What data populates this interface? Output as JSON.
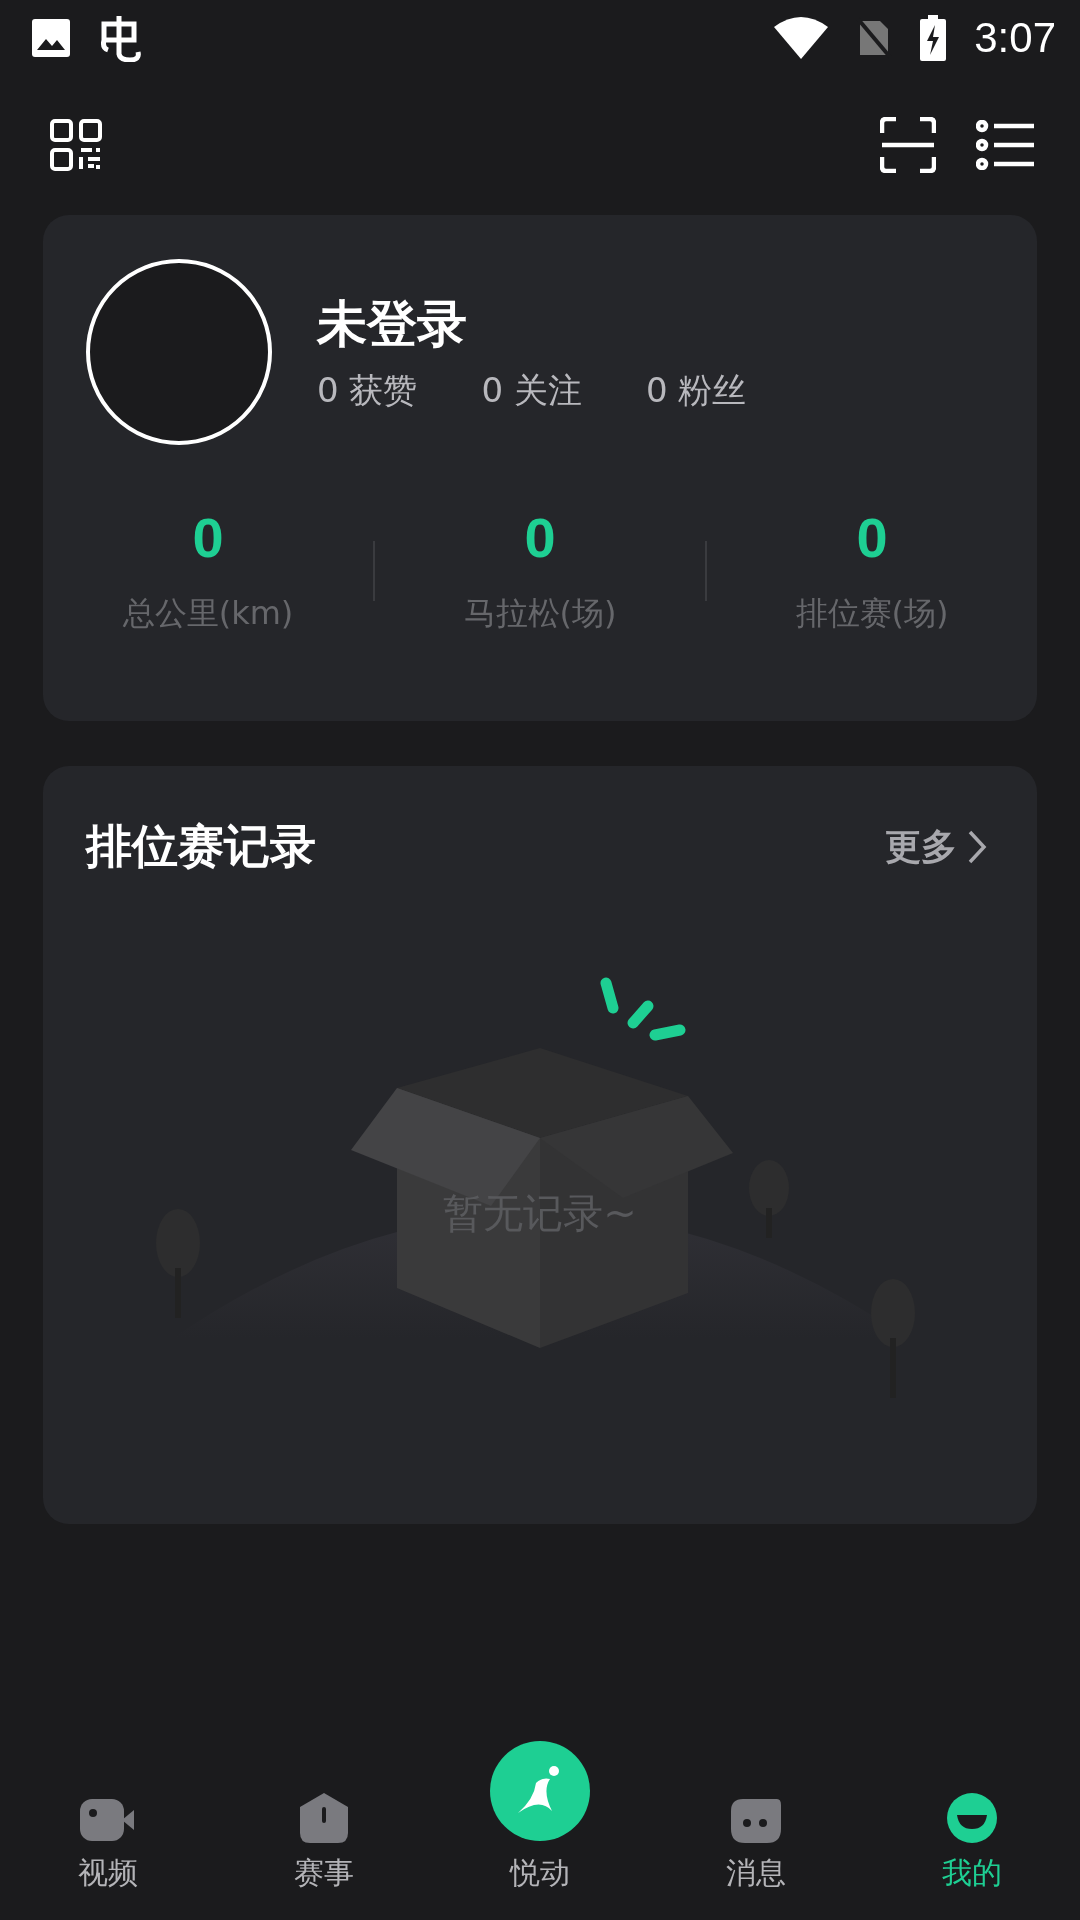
{
  "status_bar": {
    "time": "3:07"
  },
  "profile": {
    "name": "未登录",
    "counts": [
      "0 获赞",
      "0 关注",
      "0 粉丝"
    ],
    "metrics": [
      {
        "value": "0",
        "label": "总公里(km)"
      },
      {
        "value": "0",
        "label": "马拉松(场)"
      },
      {
        "value": "0",
        "label": "排位赛(场)"
      }
    ]
  },
  "records": {
    "title": "排位赛记录",
    "more": "更多",
    "empty_text": "暂无记录~"
  },
  "tabs": [
    {
      "kind": "video",
      "label": "视频",
      "selected": false
    },
    {
      "kind": "match",
      "label": "赛事",
      "selected": false
    },
    {
      "kind": "run",
      "label": "悦动",
      "selected": false
    },
    {
      "kind": "message",
      "label": "消息",
      "selected": false
    },
    {
      "kind": "me",
      "label": "我的",
      "selected": true
    }
  ]
}
